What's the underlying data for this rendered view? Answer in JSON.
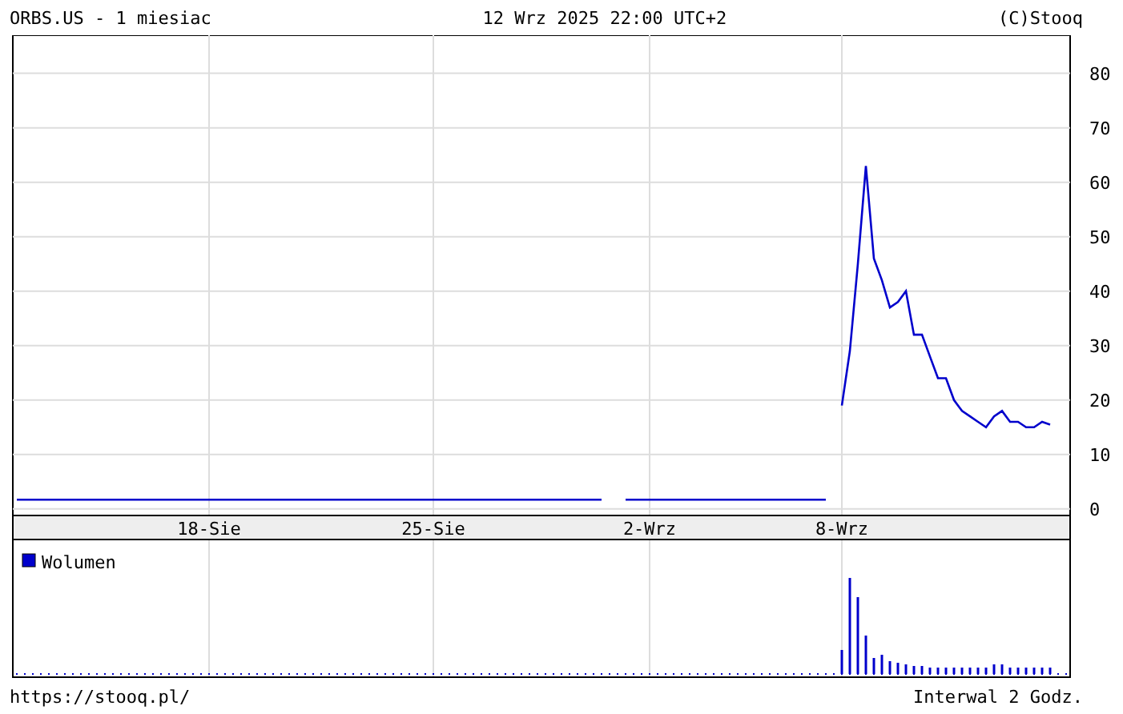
{
  "header": {
    "title": "ORBS.US - 1 miesiac",
    "timestamp": "12 Wrz 2025 22:00 UTC+2",
    "copyright": "(C)Stooq"
  },
  "price_chart": {
    "chart_data": {
      "type": "line",
      "grid": true,
      "ylim": [
        -1.2,
        87
      ],
      "yticks": [
        0,
        10,
        20,
        30,
        40,
        50,
        60,
        70,
        80
      ],
      "categories": [
        null,
        null,
        null,
        null,
        null,
        null,
        null,
        null,
        null,
        null,
        null,
        null,
        null,
        null,
        null,
        null,
        null,
        null,
        null,
        null,
        null,
        null,
        null,
        null,
        "18-Sie",
        null,
        null,
        null,
        null,
        null,
        null,
        null,
        null,
        null,
        null,
        null,
        null,
        null,
        null,
        null,
        null,
        null,
        null,
        null,
        null,
        null,
        null,
        null,
        null,
        null,
        null,
        null,
        "25-Sie",
        null,
        null,
        null,
        null,
        null,
        null,
        null,
        null,
        null,
        null,
        null,
        null,
        null,
        null,
        null,
        null,
        null,
        null,
        null,
        null,
        null,
        null,
        null,
        null,
        null,
        null,
        "2-Wrz",
        null,
        null,
        null,
        null,
        null,
        null,
        null,
        null,
        null,
        null,
        null,
        null,
        null,
        null,
        null,
        null,
        null,
        null,
        null,
        null,
        null,
        null,
        null,
        "8-Wrz",
        null,
        null,
        null,
        null,
        null,
        null,
        null,
        null,
        null,
        null,
        null,
        null,
        null,
        null,
        null,
        null,
        null,
        null,
        null,
        null,
        null,
        null,
        null,
        null,
        null,
        null,
        null,
        null
      ],
      "series": [
        {
          "color": "#0000cc",
          "values": [
            1.7,
            1.7,
            1.7,
            1.7,
            1.7,
            1.7,
            1.7,
            1.7,
            1.7,
            1.7,
            1.7,
            1.7,
            1.7,
            1.7,
            1.7,
            1.7,
            1.7,
            1.7,
            1.7,
            1.7,
            1.7,
            1.7,
            1.7,
            1.7,
            1.7,
            1.7,
            1.7,
            1.7,
            1.7,
            1.7,
            1.7,
            1.7,
            1.7,
            1.7,
            1.7,
            1.7,
            1.7,
            1.7,
            1.7,
            1.7,
            1.7,
            1.7,
            1.7,
            1.7,
            1.7,
            1.7,
            1.7,
            1.7,
            1.7,
            1.7,
            1.7,
            1.7,
            1.7,
            1.7,
            1.7,
            1.7,
            1.7,
            1.7,
            1.7,
            1.7,
            1.7,
            1.7,
            1.7,
            1.7,
            1.7,
            1.7,
            1.7,
            1.7,
            1.7,
            1.7,
            1.7,
            1.7,
            1.7,
            1.7,
            null,
            null,
            1.7,
            1.7,
            1.7,
            1.7,
            1.7,
            1.7,
            1.7,
            1.7,
            1.7,
            1.7,
            1.7,
            1.7,
            1.7,
            1.7,
            1.7,
            1.7,
            1.7,
            1.7,
            1.7,
            1.7,
            1.7,
            1.7,
            1.7,
            1.7,
            1.7,
            1.7,
            null,
            19,
            29,
            45,
            63,
            46,
            42,
            37,
            38,
            40,
            32,
            32,
            28,
            24,
            24,
            20,
            18,
            17,
            16,
            15,
            17,
            18,
            16,
            16,
            15,
            15,
            16,
            15.5,
            null,
            null
          ]
        }
      ]
    }
  },
  "volume_panel": {
    "legend": "Wolumen"
  },
  "footer": {
    "url": "https://stooq.pl/",
    "interval": "Interwal 2 Godz."
  }
}
